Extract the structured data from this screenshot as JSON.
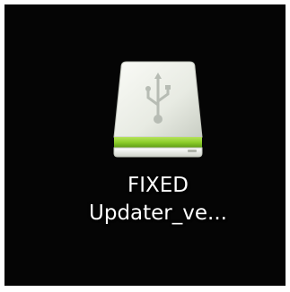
{
  "desktop": {
    "background_color": "#050505",
    "icon": {
      "icon_name": "usb-drive-icon",
      "label_line_1": "FIXED",
      "label_line_2": "Updater_ve...",
      "colors": {
        "drive_body": "#e9ece4",
        "drive_band": "#8ccd2a",
        "usb_symbol": "#b7bcb4"
      }
    }
  }
}
